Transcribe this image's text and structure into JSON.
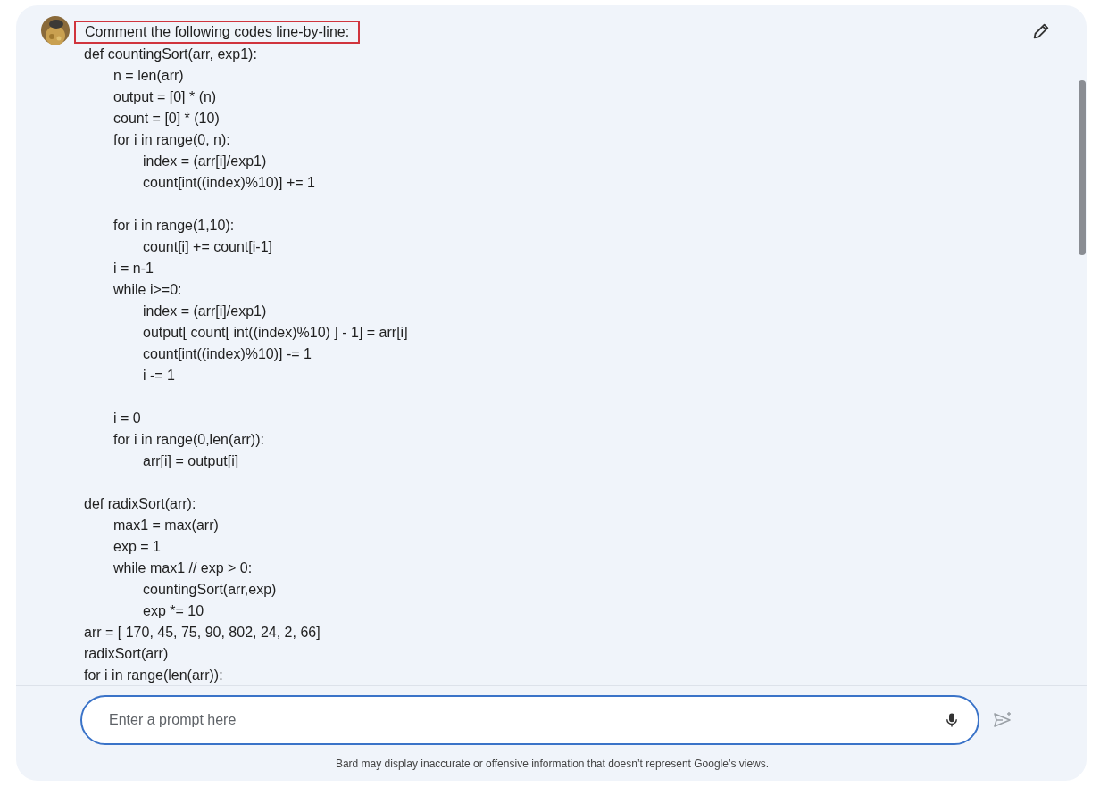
{
  "message": {
    "prompt": "Comment the following codes line-by-line:",
    "prompt_highlighted": true,
    "code": [
      {
        "text": "def countingSort(arr, exp1):",
        "children": [
          {
            "text": "n = len(arr)"
          },
          {
            "text": "output = [0] * (n)"
          },
          {
            "text": "count = [0] * (10)"
          },
          {
            "text": "for i in range(0, n):",
            "children": [
              {
                "text": "index = (arr[i]/exp1)"
              },
              {
                "text": "count[int((index)%10)] += 1"
              }
            ]
          },
          {
            "text": "for i in range(1,10):",
            "blank_before": true,
            "children": [
              {
                "text": "count[i] += count[i-1]"
              }
            ]
          },
          {
            "text": "i = n-1"
          },
          {
            "text": "while i>=0:",
            "children": [
              {
                "text": "index = (arr[i]/exp1)"
              },
              {
                "text": "output[ count[ int((index)%10) ] - 1] = arr[i]"
              },
              {
                "text": "count[int((index)%10)] -= 1"
              },
              {
                "text": "i -= 1"
              }
            ]
          },
          {
            "text": "i = 0",
            "blank_before": true
          },
          {
            "text": "for i in range(0,len(arr)):",
            "children": [
              {
                "text": "arr[i] = output[i]"
              }
            ]
          }
        ]
      },
      {
        "text": "def radixSort(arr):",
        "blank_before": true,
        "children": [
          {
            "text": "max1 = max(arr)"
          },
          {
            "text": "exp = 1"
          },
          {
            "text": "while max1 // exp > 0:",
            "children": [
              {
                "text": "countingSort(arr,exp)"
              },
              {
                "text": "exp *= 10"
              }
            ]
          }
        ]
      },
      {
        "text": "arr = [ 170, 45, 75, 90, 802, 24, 2, 66]"
      },
      {
        "text": "radixSort(arr)"
      },
      {
        "text": "for i in range(len(arr)):"
      }
    ]
  },
  "input": {
    "placeholder": "Enter a prompt here"
  },
  "send": {
    "disabled": true
  },
  "disclaimer": "Bard may display inaccurate or offensive information that doesn’t represent Google’s views."
}
